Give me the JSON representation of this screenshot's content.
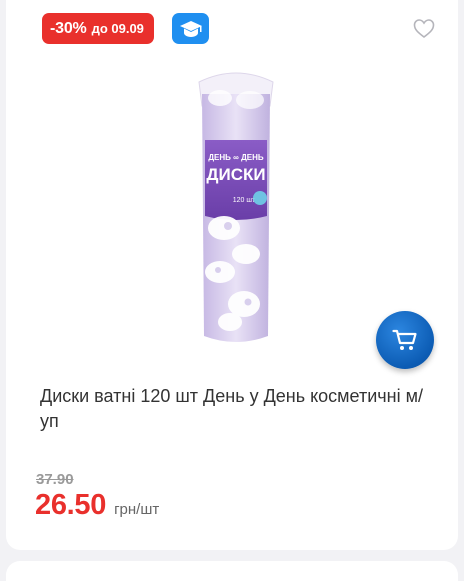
{
  "badges": {
    "discount_percent": "-30%",
    "discount_until": "до 09.09",
    "discount_color": "#e9302c",
    "edu_icon": "graduation-cap-icon",
    "edu_color": "#1f8ff0"
  },
  "favorite": {
    "icon": "heart-outline-icon"
  },
  "product": {
    "package_brand": "ДЕНЬ ∞ ДЕНЬ",
    "package_name": "ДИСКИ",
    "package_count": "120 шт",
    "title": "Диски ватні 120 шт День у День косметичні м/уп"
  },
  "cart": {
    "icon": "cart-icon",
    "color": "#0c5cb4"
  },
  "price": {
    "old": "37.90",
    "new": "26.50",
    "unit": "грн/шт"
  }
}
